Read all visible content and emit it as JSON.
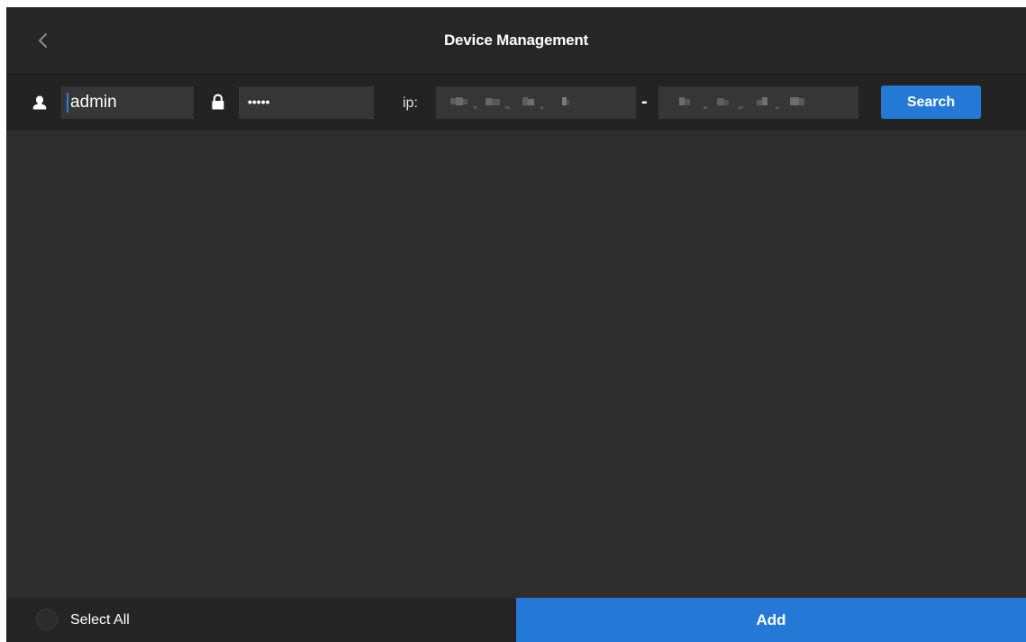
{
  "header": {
    "title": "Device Management",
    "back_icon": "chevron-left-icon"
  },
  "toolbar": {
    "username_icon": "user-icon",
    "username": "admin",
    "password_icon": "lock-icon",
    "password_display": "•••••",
    "ip_label": "ip:",
    "ip_separator": "-",
    "search_label": "Search"
  },
  "footer": {
    "select_all_label": "Select All",
    "add_label": "Add"
  },
  "colors": {
    "accent": "#2479d6",
    "background": "#2e2e2e",
    "header_bg": "#262626",
    "toolbar_bg": "#232323",
    "field_bg": "#363636"
  }
}
